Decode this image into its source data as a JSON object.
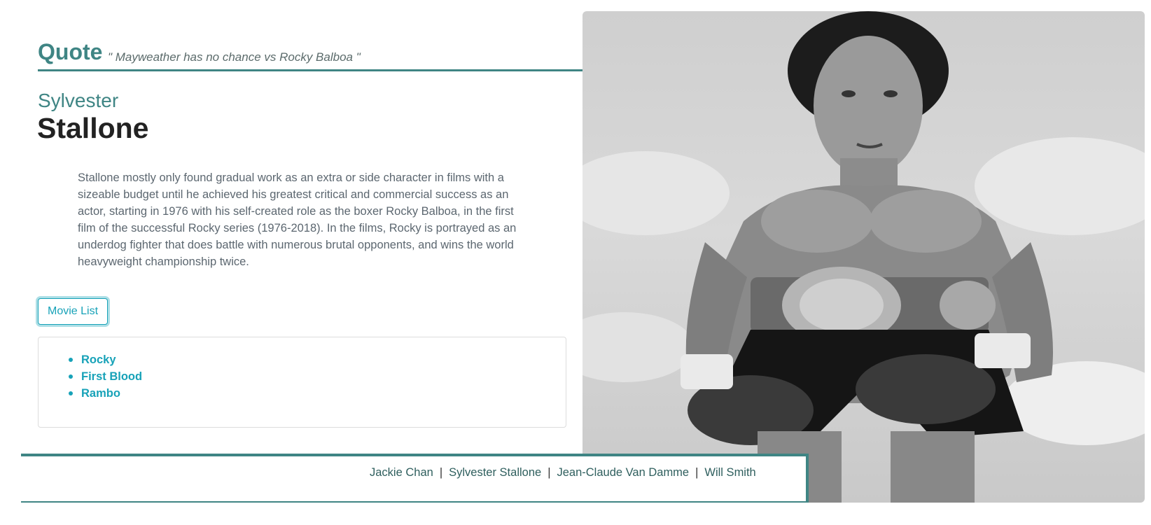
{
  "quote": {
    "title": "Quote",
    "text": "\" Mayweather has no chance vs Rocky Balboa \""
  },
  "actor": {
    "first_name": "Sylvester",
    "last_name": "Stallone",
    "bio": "Stallone mostly only found gradual work as an extra or side character in films with a sizeable budget until he achieved his greatest critical and commercial success as an actor, starting in 1976 with his self-created role as the boxer Rocky Balboa, in the first film of the successful Rocky series (1976-2018). In the films, Rocky is portrayed as an underdog fighter that does battle with numerous brutal opponents, and wins the world heavyweight championship twice."
  },
  "movie_list": {
    "button_label": "Movie List",
    "items": [
      "Rocky",
      "First Blood",
      "Rambo"
    ]
  },
  "footer": {
    "links": [
      "Jackie Chan",
      "Sylvester Stallone",
      "Jean-Claude Van Damme",
      "Will Smith"
    ],
    "separator": "|"
  },
  "photo": {
    "icon": "boxer-photo"
  },
  "colors": {
    "accent_teal": "#3f8584",
    "link_cyan": "#17a2b8",
    "heading_dark": "#222222",
    "body_text": "#5c6770"
  }
}
